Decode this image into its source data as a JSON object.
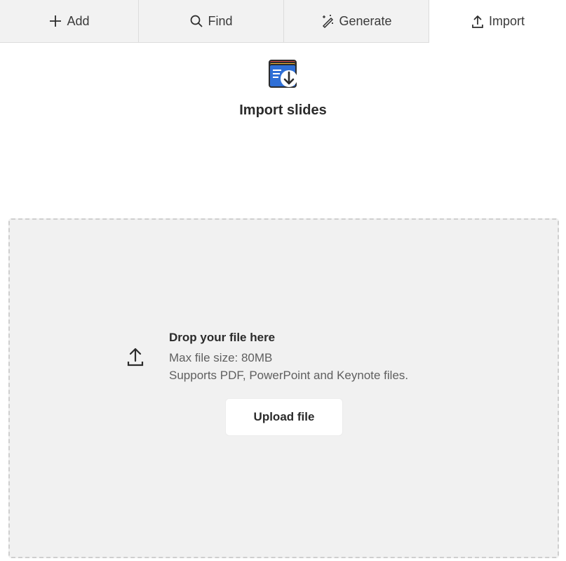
{
  "tabs": [
    {
      "label": "Add",
      "icon": "plus-icon",
      "active": false
    },
    {
      "label": "Find",
      "icon": "search-icon",
      "active": false
    },
    {
      "label": "Generate",
      "icon": "magic-wand-icon",
      "active": false
    },
    {
      "label": "Import",
      "icon": "upload-icon",
      "active": true
    }
  ],
  "header": {
    "icon": "import-slides-icon",
    "title": "Import slides"
  },
  "dropzone": {
    "icon": "upload-icon",
    "title": "Drop your file here",
    "max_size": "Max file size: 80MB",
    "supported": "Supports PDF, PowerPoint and Keynote files.",
    "button_label": "Upload file"
  },
  "colors": {
    "tab_inactive_bg": "#f2f2f2",
    "dropzone_bg": "#f1f1f1",
    "text_primary": "#2b2b2b",
    "icon_blue": "#2f6fd6",
    "icon_red": "#d64545",
    "icon_yellow": "#f2b632"
  }
}
